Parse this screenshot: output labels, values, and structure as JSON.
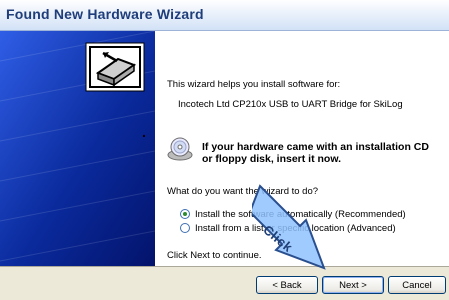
{
  "window": {
    "title": "Found New Hardware Wizard"
  },
  "content": {
    "intro_text": "This wizard helps you install software for:",
    "device_name": "Incotech Ltd CP210x USB to UART Bridge for SkiLog",
    "cd_hint": "If your hardware came with an installation CD or floppy disk, insert it now.",
    "question": "What do you want the wizard to do?",
    "options": [
      {
        "label": "Install the software automatically (Recommended)",
        "selected": true
      },
      {
        "label": "Install from a list or specific location (Advanced)",
        "selected": false
      }
    ],
    "continue_text": "Click Next to continue."
  },
  "buttons": {
    "back": "< Back",
    "next": "Next >",
    "cancel": "Cancel"
  },
  "annotation": {
    "pointer_text": "Click",
    "pointer_color": "#8fc2ff"
  },
  "colors": {
    "banner_blue": "#0a2a9c",
    "banner_light": "#2f5ee6",
    "title_text": "#1f3d7a"
  },
  "icons": [
    "hardware-wizard-icon",
    "cd-disk-icon",
    "pointer-arrow-icon"
  ]
}
